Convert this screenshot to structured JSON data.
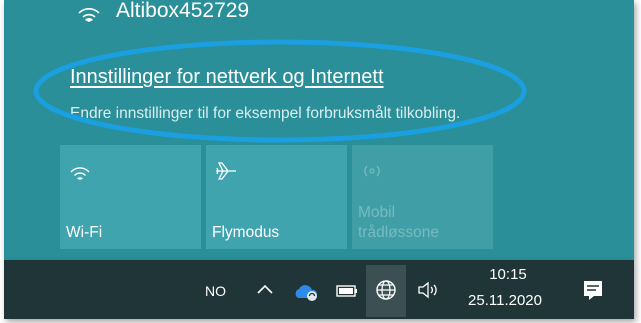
{
  "network": {
    "name": "Altibox452729",
    "icon": "wifi-icon"
  },
  "settings": {
    "link_label": "Innstillinger for nettverk og Internett",
    "description": "Endre innstillinger til for eksempel forbruksmålt tilkobling."
  },
  "highlight_color": "#1a9fe0",
  "tiles": [
    {
      "label": "Wi-Fi",
      "icon": "wifi-icon",
      "state": "on"
    },
    {
      "label": "Flymodus",
      "icon": "airplane-icon",
      "state": "off"
    },
    {
      "label_line1": "Mobil",
      "label_line2": "trådløssone",
      "icon": "mobile-hotspot-icon",
      "state": "disabled"
    }
  ],
  "taskbar": {
    "language": "NO",
    "time": "10:15",
    "date": "25.11.2020",
    "icons": [
      "chevron-up-icon",
      "onedrive-icon",
      "battery-icon",
      "globe-network-icon",
      "speaker-icon",
      "notification-icon"
    ]
  },
  "colors": {
    "panel_bg": "#2a8f99",
    "tile_bg": "#3fa4ae",
    "taskbar_bg": "#1f3538"
  }
}
